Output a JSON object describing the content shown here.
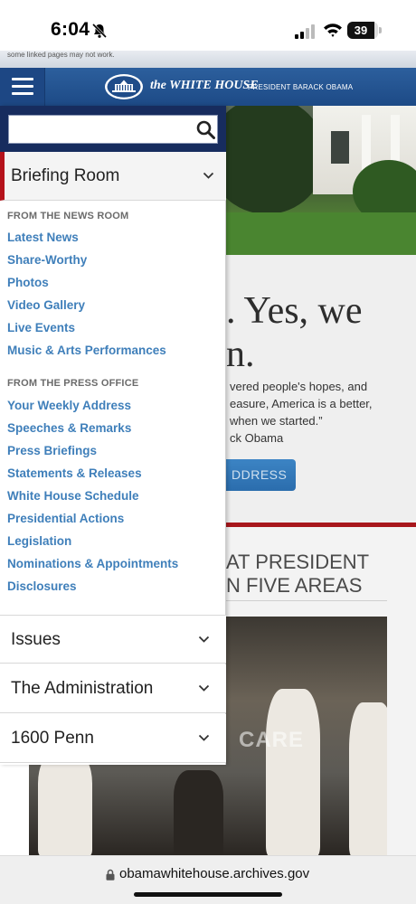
{
  "status_bar": {
    "time": "6:04",
    "battery_level": "39",
    "icons": [
      "bell-slash-icon",
      "cellular-signal-icon",
      "wifi-icon",
      "battery-icon"
    ]
  },
  "notice_strip": {
    "text": "some linked pages may not work."
  },
  "header": {
    "menu_icon": "hamburger-icon",
    "logo_title": "the WHITE HOUSE",
    "logo_subtitle": "PRESIDENT BARACK OBAMA"
  },
  "search": {
    "value": "",
    "placeholder": "",
    "icon": "search-icon"
  },
  "drawer": {
    "open_section": {
      "label": "Briefing Room",
      "groups": [
        {
          "heading": "FROM THE NEWS ROOM",
          "links": [
            "Latest News",
            "Share-Worthy",
            "Photos",
            "Video Gallery",
            "Live Events",
            "Music & Arts Performances"
          ]
        },
        {
          "heading": "FROM THE PRESS OFFICE",
          "links": [
            "Your Weekly Address",
            "Speeches & Remarks",
            "Press Briefings",
            "Statements & Releases",
            "White House Schedule",
            "Presidential Actions",
            "Legislation",
            "Nominations & Appointments",
            "Disclosures"
          ]
        }
      ]
    },
    "collapsed_sections": [
      "Issues",
      "The Administration",
      "1600 Penn"
    ]
  },
  "background_page": {
    "headline_line1": ". Yes, we",
    "headline_line2": "n.",
    "quote_lines": [
      "vered people's hopes, and",
      "easure, America is a better,",
      "when we started.”",
      "ck Obama"
    ],
    "address_button": "DDRESS",
    "section_line1": "AT PRESIDENT",
    "section_line2": "N FIVE AREAS",
    "photo_label": "CARE"
  },
  "browser": {
    "url": "obamawhitehouse.archives.gov",
    "lock_icon": "lock-icon"
  },
  "colors": {
    "header_blue": "#2c5f9d",
    "search_panel": "#172c5e",
    "link_blue": "#3f7fba",
    "accent_red": "#b5121b"
  }
}
